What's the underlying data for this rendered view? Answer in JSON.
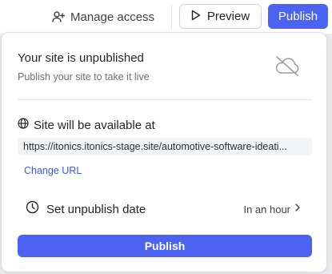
{
  "toolbar": {
    "manage_access_label": "Manage access",
    "preview_label": "Preview",
    "publish_label": "Publish"
  },
  "panel": {
    "title": "Your site is unpublished",
    "subtitle": "Publish your site to take it live",
    "availability_label": "Site will be available at",
    "url": "https://itonics.itonics-stage.site/automotive-software-ideati...",
    "change_url_label": "Change URL",
    "unpublish_label": "Set unpublish date",
    "unpublish_value": "In an hour",
    "publish_label": "Publish"
  },
  "colors": {
    "accent": "#4c63f2",
    "link": "#3b56e0",
    "muted_text": "#6b6f76"
  },
  "icons": {
    "manage_access": "user-plus-icon",
    "preview": "play-icon",
    "status": "cloud-off-icon",
    "availability": "globe-icon",
    "unpublish": "clock-icon",
    "disclosure": "chevron-right-icon"
  }
}
